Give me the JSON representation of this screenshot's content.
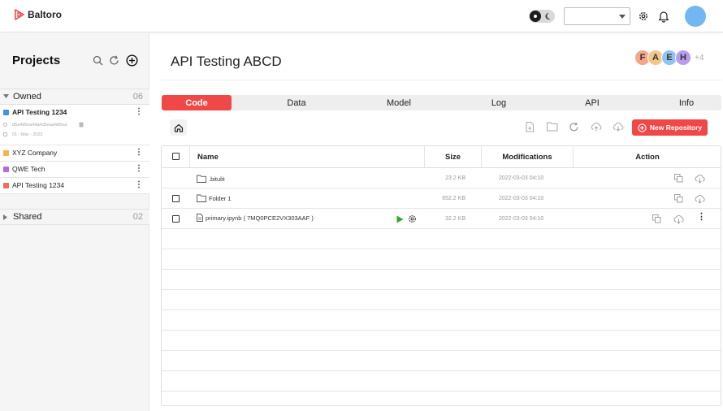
{
  "app": {
    "brand": "Baltoro"
  },
  "topbar": {
    "select_value": "",
    "icons": [
      "theme-toggle",
      "gear-icon",
      "bell-icon",
      "avatar"
    ]
  },
  "sidebar": {
    "title": "Projects",
    "owned": {
      "label": "Owned",
      "count": "06",
      "projects": [
        {
          "name": "API Testing 1234",
          "color": "#4a90e2",
          "id": "d5a4d5ea4da4d5eaa4d5ea",
          "date": "01 - Mar - 2022"
        },
        {
          "name": "XYZ Company",
          "color": "#f5b44a"
        },
        {
          "name": "QWE Tech",
          "color": "#b66ae0"
        },
        {
          "name": "API Testing 1234",
          "color": "#f06a6a"
        }
      ]
    },
    "shared": {
      "label": "Shared",
      "count": "02"
    }
  },
  "main": {
    "title": "API Testing ABCD",
    "members": [
      {
        "initial": "F",
        "color": "#f4a58a"
      },
      {
        "initial": "A",
        "color": "#f3c78a"
      },
      {
        "initial": "E",
        "color": "#8ec3f2"
      },
      {
        "initial": "H",
        "color": "#b99cf0"
      }
    ],
    "members_more": "+4",
    "tabs": [
      "Code",
      "Data",
      "Model",
      "Log",
      "API",
      "Info"
    ],
    "active_tab": "Code",
    "new_repo_label": "New Repository",
    "table": {
      "headers": {
        "name": "Name",
        "size": "Size",
        "mod": "Modifications",
        "action": "Action"
      },
      "rows": [
        {
          "name": ".bitulit",
          "type": "folder",
          "size": "23.2 KB",
          "mod": "2022-03-03 04:10"
        },
        {
          "name": "Folder 1",
          "type": "folder",
          "size": "652.2 KB",
          "mod": "2022-03-03 04:10"
        },
        {
          "name": "primary.ipynb ( 7MQ0PCE2VX303AAF )",
          "type": "file",
          "size": "32.2 KB",
          "mod": "2022-03-03 04:10"
        }
      ]
    }
  },
  "colors": {
    "accent": "#f04747",
    "run": "#2fa82f"
  }
}
